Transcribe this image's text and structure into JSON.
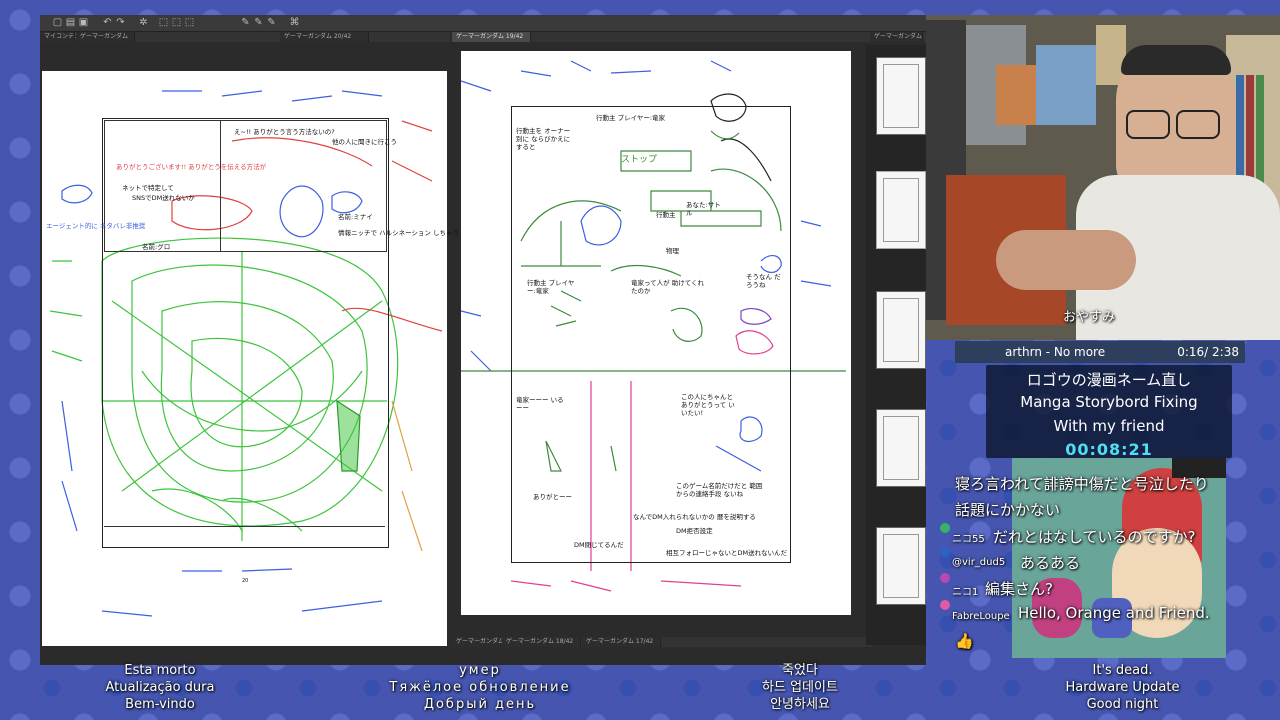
{
  "app": {
    "tabs": [
      "マイコンテンツ",
      "ゲーマーガンダム",
      "ゲーマーガンダム 20/42",
      "ゲーマーガンダム 19/42",
      "ゲーマーガンダム"
    ],
    "bottom_tabs": [
      "ゲーマーガンダム",
      "ゲーマーガンダム 18/42",
      "ゲーマーガンダム 17/42"
    ],
    "page_left": {
      "balloons": [
        "え~!! ありがとう言う方法ないの?",
        "他の人に聞きに行こう",
        "ありがとうございます!! ありがとうを伝える方法が",
        "ネットで特定して",
        "SNSでDM送れないか",
        "名前:ミナイ",
        "情報ニッチで ハルシネーション しちゃう",
        "名前:グロ",
        "エージェント的に ネタバレ非推奨"
      ],
      "page_number": "20"
    },
    "page_right": {
      "balloons": [
        "行動主 プレイヤー:竜家",
        "行動主を オーナー別に ならびかえにすると",
        "ストップ",
        "あなた:サトル",
        "行動主",
        "物理",
        "行動主 プレイヤー:竜家",
        "竜家って人が 助けてくれたのか",
        "そうなん だろうね",
        "竜家ーーー いるーー",
        "この人にちゃんと ありがとうって いいたい!",
        "ありがとーー",
        "このゲーム名前だけだと 範囲からの連絡手段 ないね",
        "なんでDM入れられないかの 暦を説明する",
        "DM拒否設定",
        "DM閉じてるんだ",
        "相互フォローじゃないとDM送れないんだ"
      ]
    }
  },
  "webcam": {
    "caption": "おやすみ"
  },
  "music": {
    "title": "arthrn - No more",
    "time": "0:16/ 2:38"
  },
  "overlay": {
    "line1": "ロゴウの漫画ネーム直し",
    "line2": "Manga Storybord Fixing",
    "line3": "With my friend",
    "timer": "00:08:21"
  },
  "chat": [
    {
      "user": "",
      "message": "寝ろ言われて誹謗中傷だと号泣したり"
    },
    {
      "user": "",
      "message": "話題にかかない"
    },
    {
      "user": "ニコ55",
      "message": "だれとはなしているのですか?",
      "color": "#36b36b"
    },
    {
      "user": "@vir_dud5",
      "message": "あるある",
      "color": "#2b63c4"
    },
    {
      "user": "ニコ1",
      "message": "編集さん?",
      "color": "#b64ab4"
    },
    {
      "user": "FabreLoupe",
      "message": "Hello, Orange and Friend.",
      "color": "#e05aa6"
    },
    {
      "user": "",
      "message": "👍"
    }
  ],
  "subtitles": [
    {
      "lines": [
        "Esta morto",
        "Atualização dura",
        "Bem-vindo"
      ]
    },
    {
      "lines": [
        "умер",
        "Тяжёлое обновление",
        "Добрый день"
      ]
    },
    {
      "lines": [
        "죽었다",
        "하드 업데이트",
        "안녕하세요"
      ]
    },
    {
      "lines": [
        "It's dead.",
        "Hardware Update",
        "Good night"
      ]
    }
  ],
  "colors": {
    "bg": "#4656b0",
    "overlay_timer": "#4de0f0",
    "sketch_green": "#3cc43c",
    "sketch_red": "#e04040",
    "sketch_blue": "#3d5fe0",
    "sketch_pink": "#e0408c"
  }
}
